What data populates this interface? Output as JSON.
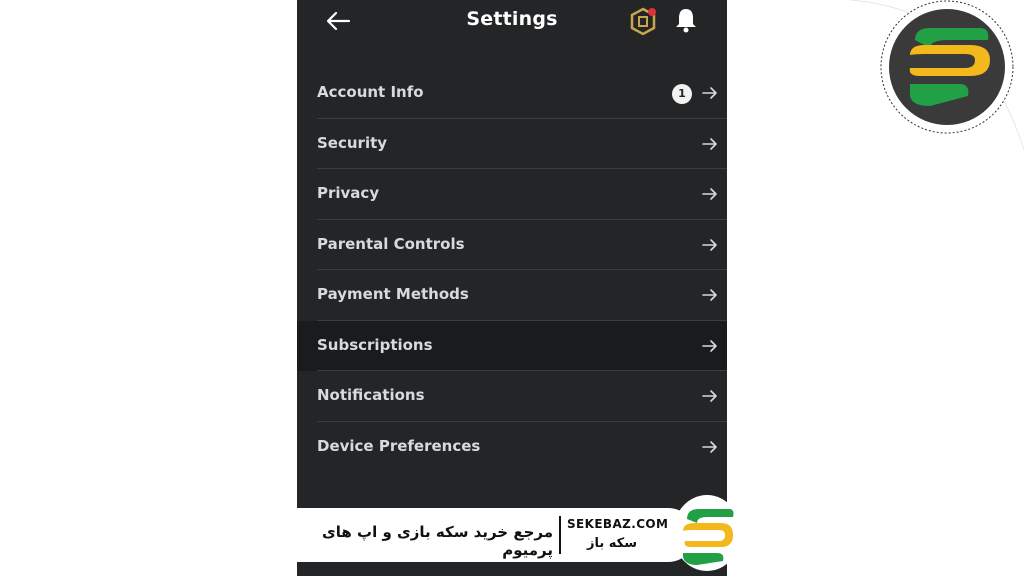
{
  "header": {
    "title": "Settings",
    "back_icon": "arrow-left-icon",
    "robux_icon": "robux-icon",
    "bell_icon": "bell-icon"
  },
  "menu": {
    "items": [
      {
        "label": "Account Info",
        "badge": "1"
      },
      {
        "label": "Security"
      },
      {
        "label": "Privacy"
      },
      {
        "label": "Parental Controls"
      },
      {
        "label": "Payment Methods"
      },
      {
        "label": "Subscriptions",
        "active": true
      },
      {
        "label": "Notifications"
      },
      {
        "label": "Device Preferences"
      }
    ]
  },
  "banner": {
    "tagline": "مرجع خرید سکه بازی و اپ های پرمیوم",
    "domain": "SEKEBAZ.COM",
    "brand": "سکه باز"
  },
  "colors": {
    "background": "#232527",
    "active_row": "#1a1b1d",
    "text": "#d9dadb",
    "logo_green": "#1f8f3a",
    "logo_yellow": "#f3b81c"
  }
}
